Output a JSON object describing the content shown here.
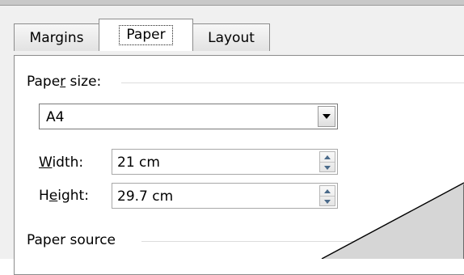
{
  "tabs": [
    {
      "label": "Margins",
      "active": false
    },
    {
      "label": "Paper",
      "active": true
    },
    {
      "label": "Layout",
      "active": false
    }
  ],
  "paper_size": {
    "section_label_pre": "Pape",
    "section_label_key": "r",
    "section_label_post": " size:",
    "selected": "A4",
    "width_label_key": "W",
    "width_label_rest": "idth:",
    "width_value": "21 cm",
    "height_label_pre": "H",
    "height_label_key": "e",
    "height_label_post": "ight:",
    "height_value": "29.7 cm"
  },
  "paper_source": {
    "section_label": "Paper source"
  },
  "icons": {
    "dropdown": "chevron-down-icon",
    "spin": "spin-arrows-icon"
  },
  "colors": {
    "dialog_bg": "#f0f0f0",
    "panel_bg": "#ffffff",
    "border": "#8c8c8c",
    "callout_fill": "#d6d6d6"
  }
}
